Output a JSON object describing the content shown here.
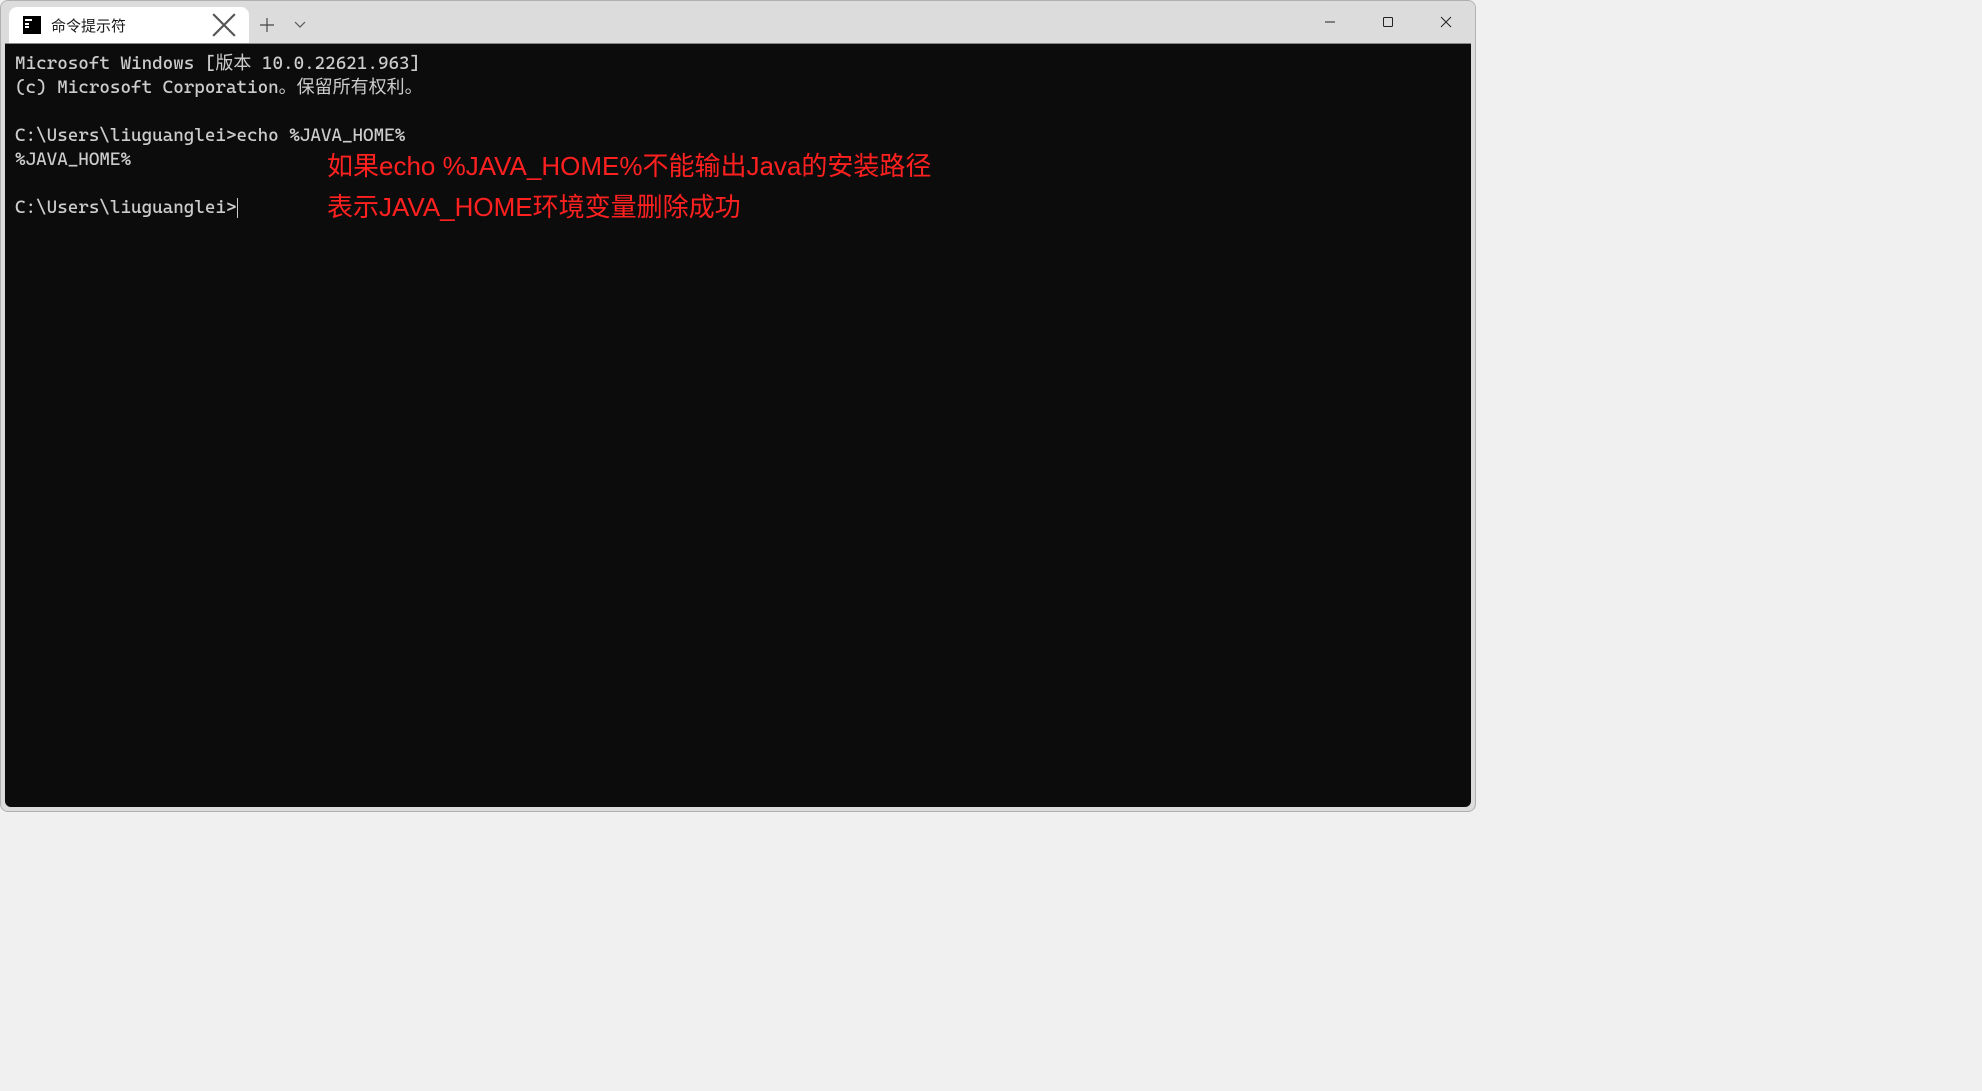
{
  "window": {
    "tab_title": "命令提示符"
  },
  "terminal": {
    "line1": "Microsoft Windows [版本 10.0.22621.963]",
    "line2": "(c) Microsoft Corporation。保留所有权利。",
    "blank1": "",
    "prompt1": "C:\\Users\\liuguanglei>echo %JAVA_HOME%",
    "output1": "%JAVA_HOME%",
    "blank2": "",
    "prompt2": "C:\\Users\\liuguanglei>"
  },
  "annotations": {
    "line1": "如果echo  %JAVA_HOME%不能输出Java的安装路径",
    "line2": "表示JAVA_HOME环境变量删除成功"
  }
}
